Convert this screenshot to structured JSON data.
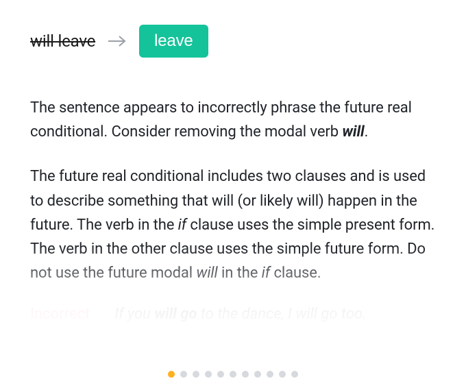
{
  "suggestion": {
    "remove": "will leave",
    "replace_with": "leave"
  },
  "explanation": {
    "p1_a": "The sentence appears to incorrectly phrase the future real conditional. Consider removing the modal verb ",
    "p1_b_bold_it": "will",
    "p1_c": ".",
    "p2_a": "The future real conditional includes two clauses and is used to describe something that will (or likely will) happen in the future. The verb in the ",
    "p2_b_it": "if",
    "p2_c": " clause uses the simple present form. The verb in the other clause uses the simple future form. Do not use the future modal ",
    "p2_d_it": "will",
    "p2_e": " in the ",
    "p2_f_it": "if",
    "p2_g": " clause."
  },
  "example": {
    "label": "Incorrect",
    "text_a": "If you ",
    "text_b_bold": "will go",
    "text_c": " to the dance, I will go too."
  },
  "colors": {
    "accent": "#15c39a",
    "warn": "#ff6b81",
    "dot_active": "#ffb020",
    "dot": "#d6d9de"
  },
  "pager": {
    "count": 11,
    "active_index": 0
  }
}
